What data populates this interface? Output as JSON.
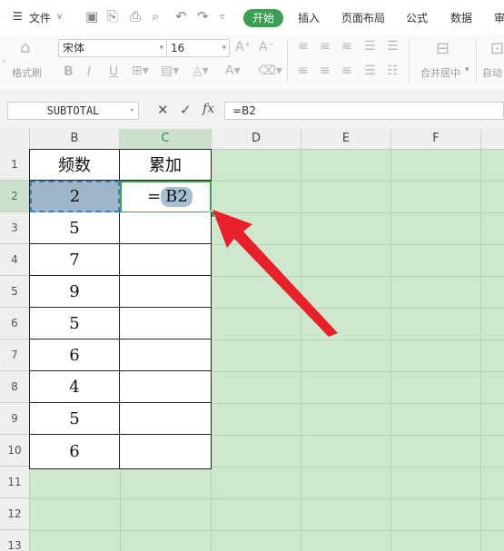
{
  "menu": {
    "file_label": "文件",
    "tabs": [
      "开始",
      "插入",
      "页面布局",
      "公式",
      "数据",
      "审"
    ],
    "active_tab": "开始"
  },
  "ribbon": {
    "format_painter_label": "格式刷",
    "font_name": "宋体",
    "font_size": "16",
    "merge_center_label": "合并居中",
    "auto_label": "自动"
  },
  "formula_bar": {
    "name_box": "SUBTOTAL",
    "fx_label": "fx",
    "content": "=B2"
  },
  "sheet": {
    "columns": [
      "B",
      "C",
      "D",
      "E",
      "F"
    ],
    "active_column": "C",
    "rows": [
      "1",
      "2",
      "3",
      "4",
      "5",
      "6",
      "7",
      "8",
      "9",
      "10",
      "11",
      "12",
      "13"
    ],
    "active_row": "2",
    "header_b": "频数",
    "header_c": "累加",
    "col_b_values": [
      "2",
      "5",
      "7",
      "9",
      "5",
      "6",
      "4",
      "5",
      "6"
    ],
    "editing_prefix": "=",
    "editing_ref": "B2"
  },
  "colors": {
    "accent_green": "#3a9f53",
    "sheet_bg": "#cde8cd",
    "ref_highlight": "#9fb6c9",
    "arrow_red": "#e8202a"
  }
}
